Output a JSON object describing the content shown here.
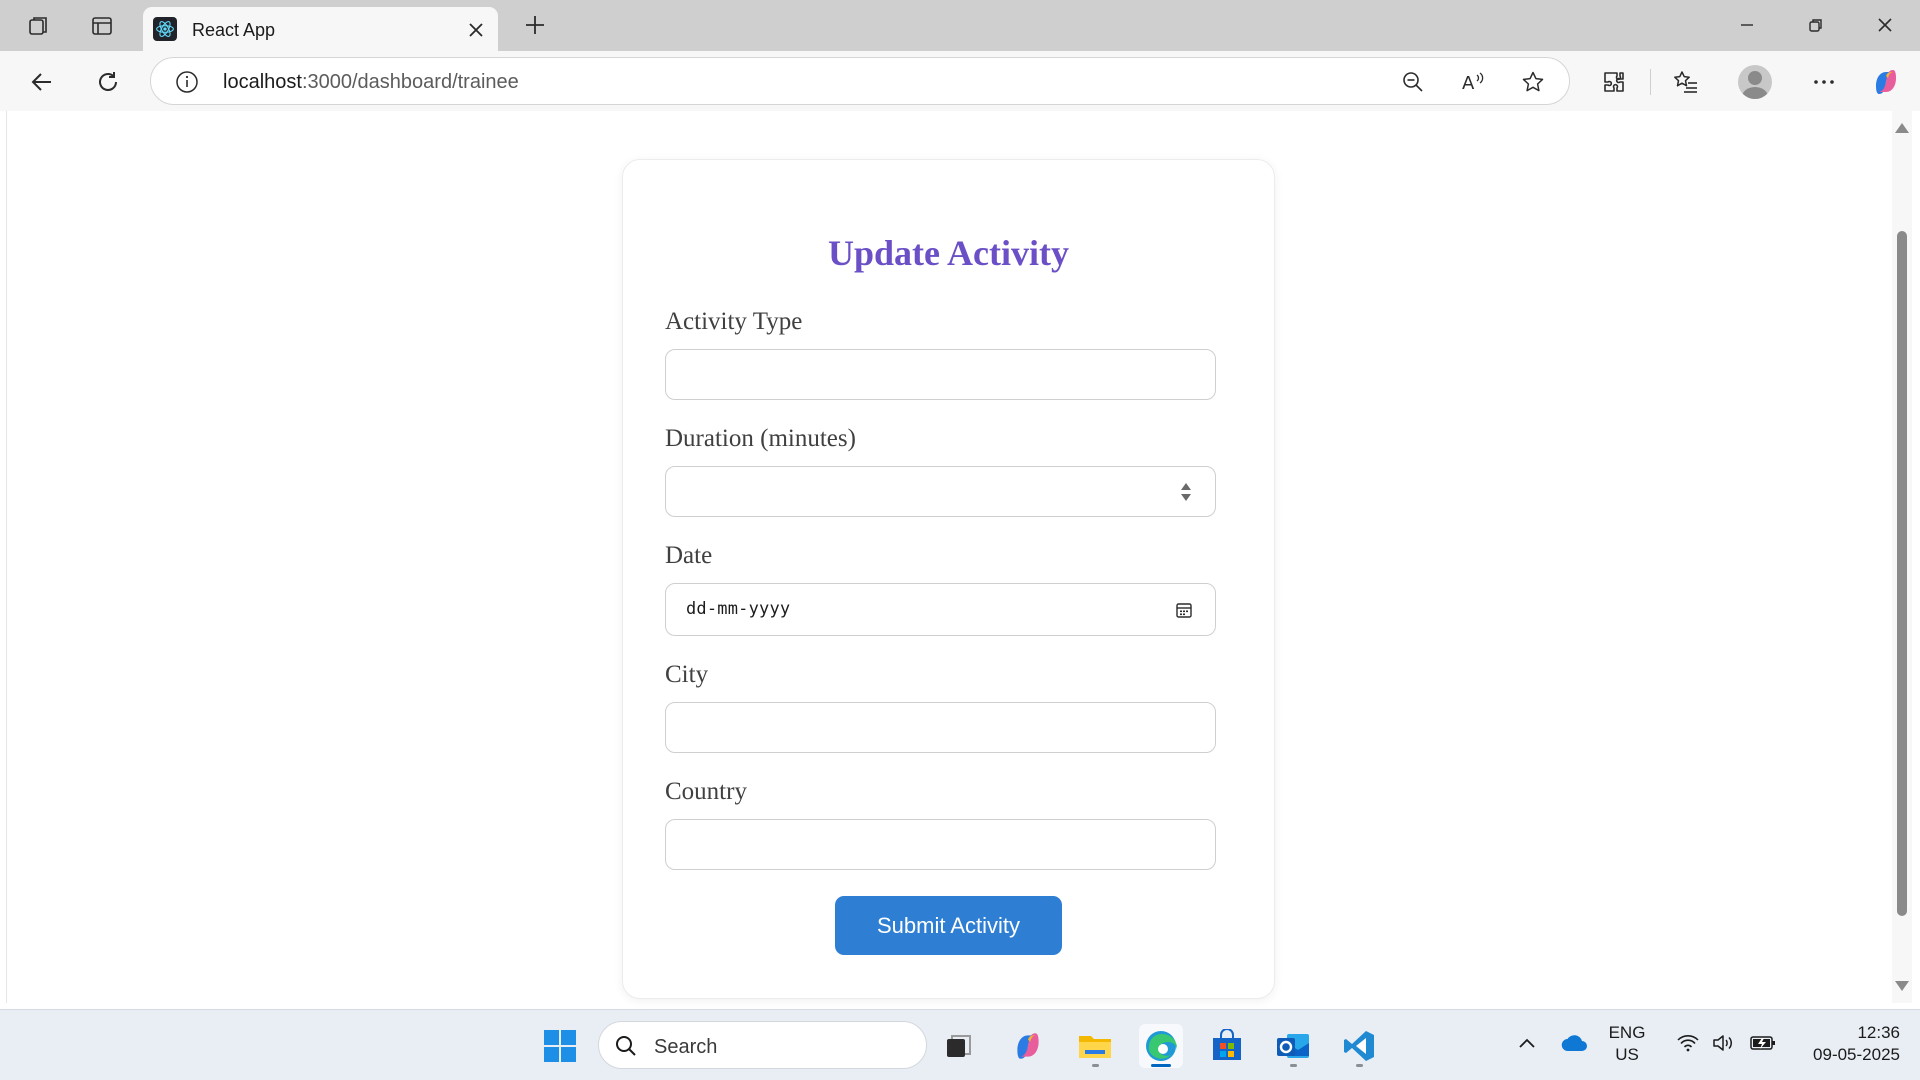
{
  "browser": {
    "tab_title": "React App",
    "url_host": "localhost",
    "url_path": ":3000/dashboard/trainee"
  },
  "form": {
    "title": "Update Activity",
    "fields": [
      {
        "label": "Activity Type",
        "type": "text",
        "value": ""
      },
      {
        "label": "Duration (minutes)",
        "type": "number",
        "value": ""
      },
      {
        "label": "Date",
        "type": "date",
        "value": "",
        "placeholder": "dd-mm-yyyy"
      },
      {
        "label": "City",
        "type": "text",
        "value": ""
      },
      {
        "label": "Country",
        "type": "text",
        "value": ""
      }
    ],
    "submit_label": "Submit Activity"
  },
  "taskbar": {
    "search_placeholder": "Search",
    "language": "ENG",
    "region": "US",
    "time": "12:36",
    "date": "09-05-2025",
    "apps": [
      "windows-start-icon",
      "search-icon",
      "task-view-icon",
      "copilot-icon",
      "file-explorer-icon",
      "edge-icon",
      "microsoft-store-icon",
      "outlook-icon",
      "vscode-icon"
    ]
  },
  "colors": {
    "title_purple": "#6a4fc6",
    "button_blue": "#2e7fd3",
    "page_bg": "#ffffff",
    "chrome_bg": "#cfcfcf"
  }
}
